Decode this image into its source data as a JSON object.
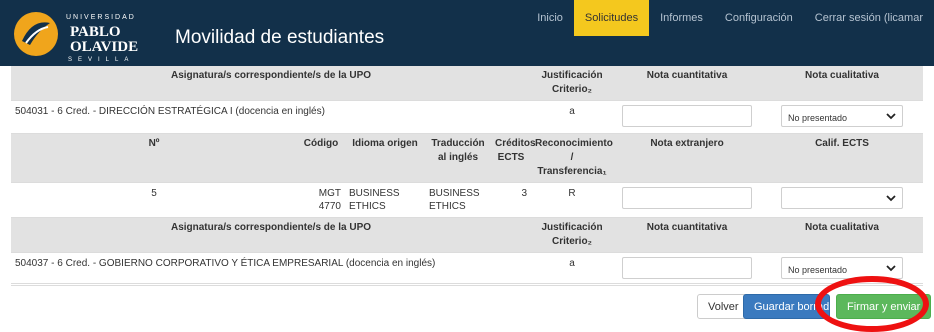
{
  "header": {
    "logo_text": "UNIVERSIDAD PABLO DE OLAVIDE SEVILLA",
    "title": "Movilidad de estudiantes",
    "nav": [
      "Inicio",
      "Solicitudes",
      "Informes",
      "Configuración",
      "Cerrar sesión (licamar"
    ]
  },
  "section1": {
    "headers": {
      "asignatura": "Asignatura/s correspondiente/s de la UPO",
      "justificacion": "Justificación Criterio₂",
      "nota_cuantitativa": "Nota cuantitativa",
      "nota_cualitativa": "Nota cualitativa"
    },
    "row": {
      "asignatura": "504031 - 6 Cred. - DIRECCIÓN ESTRATÉGICA I (docencia en inglés)",
      "justificacion": "a",
      "nota_cuantitativa_value": "",
      "nota_cualitativa_selected": "No presentado"
    }
  },
  "section2": {
    "headers": {
      "numero": "Nº",
      "codigo": "Código",
      "idioma": "Idioma origen",
      "traduccion": "Traducción al inglés",
      "creditos": "Créditos ECTS",
      "reconocimiento": "Reconocimiento / Transferencia₁",
      "nota_extranjero": "Nota extranjero",
      "calif_ects": "Calif. ECTS"
    },
    "row": {
      "numero": "5",
      "codigo": "MGT 4770",
      "idioma": "BUSINESS ETHICS",
      "traduccion": "BUSINESS ETHICS",
      "creditos": "3",
      "reconocimiento": "R",
      "nota_extranjero_value": "",
      "calif_ects_selected": ""
    }
  },
  "section3": {
    "headers": {
      "asignatura": "Asignatura/s correspondiente/s de la UPO",
      "justificacion": "Justificación Criterio₂",
      "nota_cuantitativa": "Nota cuantitativa",
      "nota_cualitativa": "Nota cualitativa"
    },
    "row": {
      "asignatura": "504037 - 6 Cred. - GOBIERNO CORPORATIVO Y ÉTICA EMPRESARIAL (docencia en inglés)",
      "justificacion": "a",
      "nota_cuantitativa_value": "",
      "nota_cualitativa_selected": "No presentado"
    }
  },
  "actions": {
    "volver": "Volver",
    "guardar": "Guardar borrador",
    "firmar": "Firmar y enviar"
  },
  "colors": {
    "header_bg": "#12304a",
    "nav_active": "#f4c81e",
    "guardar_btn": "#3a7abf",
    "firmar_btn": "#5cb85c",
    "highlight_ring": "#e11"
  }
}
